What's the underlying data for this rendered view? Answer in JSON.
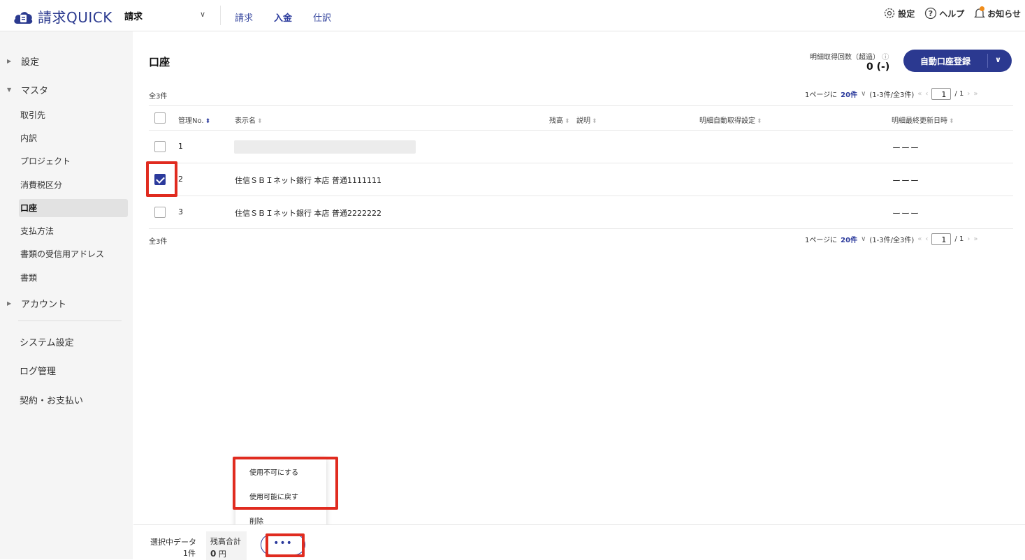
{
  "header": {
    "brand": "請求QUICK",
    "service": "請求",
    "nav": [
      "請求",
      "入金",
      "仕訳"
    ],
    "active_nav": "入金",
    "settings_label": "設定",
    "help_label": "ヘルプ",
    "notice_label": "お知らせ"
  },
  "sidebar": {
    "settings_group": "設定",
    "master_group": "マスタ",
    "master_items": [
      "取引先",
      "内訳",
      "プロジェクト",
      "消費税区分",
      "口座",
      "支払方法",
      "書類の受信用アドレス",
      "書類"
    ],
    "active_item": "口座",
    "account_group": "アカウント",
    "bottom_items": [
      "システム設定",
      "ログ管理",
      "契約・お支払い"
    ]
  },
  "main": {
    "title": "口座",
    "fetch_label": "明細取得回数（超過）",
    "fetch_value": "0 (-)",
    "auto_register_label": "自動口座登録",
    "count_top": "全3件",
    "count_bottom": "全3件",
    "pager": {
      "per_page_prefix": "1ページに",
      "per_page": "20件",
      "range": "(1-3件/全3件)",
      "first": "«",
      "prev": "‹",
      "page": "1",
      "total": "/ 1",
      "next": "›",
      "last": "»"
    },
    "columns": [
      "管理No.",
      "表示名",
      "残高",
      "説明",
      "明細自動取得設定",
      "明細最終更新日時"
    ],
    "rows": [
      {
        "no": "1",
        "name": "",
        "last_update": "ーーー",
        "checked": false
      },
      {
        "no": "2",
        "name": "住信ＳＢＩネット銀行 本店 普通1111111",
        "last_update": "ーーー",
        "checked": true
      },
      {
        "no": "3",
        "name": "住信ＳＢＩネット銀行 本店 普通2222222",
        "last_update": "ーーー",
        "checked": false
      }
    ]
  },
  "menu": {
    "items": [
      "使用不可にする",
      "使用可能に戻す",
      "削除"
    ]
  },
  "bottom_bar": {
    "selected_label": "選択中データ",
    "selected_count": "1件",
    "balance_label": "残高合計",
    "balance_value": "0",
    "balance_unit": "円",
    "more_label": "•••"
  },
  "colors": {
    "accent": "#2b3a9c",
    "highlight": "#e02b1f",
    "notice_dot": "#f08c1a"
  }
}
